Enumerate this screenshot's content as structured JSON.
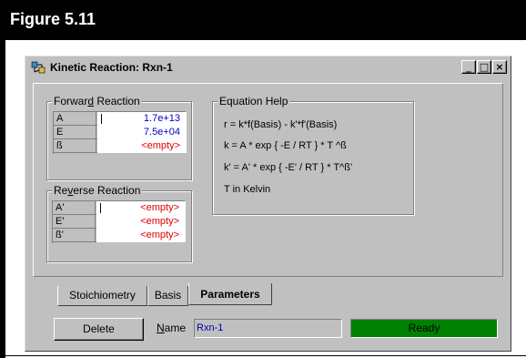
{
  "figure": {
    "title": "Figure 5.11"
  },
  "window": {
    "title": "Kinetic Reaction: Rxn-1",
    "minimize_label": "_",
    "maximize_label": "□",
    "close_label": "×"
  },
  "forward": {
    "label_pre": "Forwar",
    "label_hot": "d",
    "label_post": " Reaction",
    "rows": [
      {
        "name": "A",
        "value": "1.7e+13"
      },
      {
        "name": "E",
        "value": "7.5e+04"
      },
      {
        "name": "ß",
        "value": "<empty>"
      }
    ]
  },
  "reverse": {
    "label_pre": "Re",
    "label_hot": "v",
    "label_post": "erse Reaction",
    "rows": [
      {
        "name": "A'",
        "value": "<empty>"
      },
      {
        "name": "E'",
        "value": "<empty>"
      },
      {
        "name": "ß'",
        "value": "<empty>"
      }
    ]
  },
  "equation_help": {
    "title": "Equation Help",
    "lines": [
      "r  =  k*f(Basis) - k'*f'(Basis)",
      "k  =  A * exp { -E / RT } * T ^ß",
      "k'  =  A' * exp { -E' / RT } * T^ß'",
      "T in Kelvin"
    ]
  },
  "tabs": [
    {
      "label": "Stoichiometry"
    },
    {
      "label": "Basis"
    },
    {
      "label": "Parameters"
    }
  ],
  "footer": {
    "delete_label": "Delete",
    "name_label_hot": "N",
    "name_label_rest": "ame",
    "name_value": "Rxn-1",
    "status": "Ready"
  },
  "colors": {
    "status_green": "#008000",
    "value_blue": "#0000cc",
    "empty_red": "#e00000"
  }
}
